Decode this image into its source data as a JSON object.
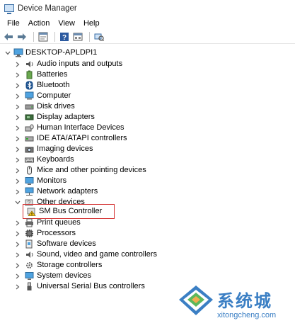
{
  "window": {
    "title": "Device Manager"
  },
  "menu": [
    "File",
    "Action",
    "View",
    "Help"
  ],
  "toolbar": [
    "back-icon",
    "forward-icon",
    "properties-icon",
    "help-icon",
    "show-hidden-icon",
    "scan-hardware-icon"
  ],
  "tree": {
    "root": "DESKTOP-APLDPI1",
    "items": [
      {
        "label": "Audio inputs and outputs",
        "icon": "speaker-icon",
        "expanded": false
      },
      {
        "label": "Batteries",
        "icon": "battery-icon",
        "expanded": false
      },
      {
        "label": "Bluetooth",
        "icon": "bluetooth-icon",
        "expanded": false
      },
      {
        "label": "Computer",
        "icon": "computer-icon",
        "expanded": false
      },
      {
        "label": "Disk drives",
        "icon": "disk-icon",
        "expanded": false
      },
      {
        "label": "Display adapters",
        "icon": "display-adapter-icon",
        "expanded": false
      },
      {
        "label": "Human Interface Devices",
        "icon": "hid-icon",
        "expanded": false
      },
      {
        "label": "IDE ATA/ATAPI controllers",
        "icon": "ide-icon",
        "expanded": false
      },
      {
        "label": "Imaging devices",
        "icon": "camera-icon",
        "expanded": false
      },
      {
        "label": "Keyboards",
        "icon": "keyboard-icon",
        "expanded": false
      },
      {
        "label": "Mice and other pointing devices",
        "icon": "mouse-icon",
        "expanded": false
      },
      {
        "label": "Monitors",
        "icon": "monitor-icon",
        "expanded": false
      },
      {
        "label": "Network adapters",
        "icon": "network-icon",
        "expanded": false
      },
      {
        "label": "Other devices",
        "icon": "unknown-device-icon",
        "expanded": true
      },
      {
        "label": "SM Bus Controller",
        "icon": "warning-device-icon",
        "child": true
      },
      {
        "label": "Print queues",
        "icon": "printer-icon",
        "expanded": false
      },
      {
        "label": "Processors",
        "icon": "processor-icon",
        "expanded": false
      },
      {
        "label": "Software devices",
        "icon": "software-device-icon",
        "expanded": false
      },
      {
        "label": "Sound, video and game controllers",
        "icon": "sound-icon",
        "expanded": false
      },
      {
        "label": "Storage controllers",
        "icon": "storage-icon",
        "expanded": false
      },
      {
        "label": "System devices",
        "icon": "system-icon",
        "expanded": false
      },
      {
        "label": "Universal Serial Bus controllers",
        "icon": "usb-icon",
        "expanded": false
      }
    ]
  },
  "watermark": {
    "text": "系统城",
    "url": "xitongcheng.com"
  },
  "colors": {
    "highlight_box": "#d43131",
    "accent": "#3b7fc4"
  }
}
